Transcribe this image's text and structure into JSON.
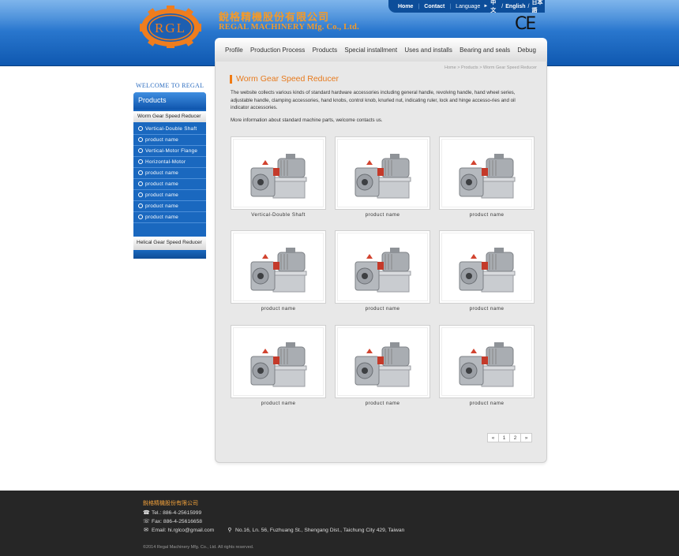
{
  "header": {
    "company_cn": "銳格精機股份有限公司",
    "company_en": "REGAL MACHINERY Mfg. Co., Ltd.",
    "logo_text": "RGL",
    "ce_mark": "CE"
  },
  "topbar": {
    "home": "Home",
    "contact": "Contact",
    "language": "Language",
    "lang_options": [
      "中文",
      "English",
      "日本語"
    ]
  },
  "nav": [
    "Profile",
    "Production Process",
    "Products",
    "Special installment",
    "Uses and installs",
    "Bearing and seals",
    "Debug"
  ],
  "sidebar": {
    "welcome": "WELCOME TO REGAL",
    "heading": "Products",
    "category_selected": "Worm Gear Speed Reducer",
    "items": [
      "Vertical-Double Shaft",
      "product name",
      "Vertical-Motor Flange",
      "Horizontal-Motor",
      "product name",
      "product name",
      "product name",
      "product name",
      "product name"
    ],
    "category_other": "Helical Gear Speed Reducer"
  },
  "main": {
    "breadcrumb": "Home > Products > Worm Gear Speed Reducer",
    "title": "Worm Gear Speed Reducer",
    "description": "The website collects various kinds of standard hardware accessories including general handle, revolving handle, hand wheel series, adjustable handle, clamping accessories, hand knobs, control knob, knurled nut, indicating ruler, lock and hinge accesso-ries and oil indicator accessories.",
    "more_info": "More information about standard machine parts, welcome contacts us.",
    "products": [
      "Vertical-Double Shaft",
      "product name",
      "product name",
      "product name",
      "product name",
      "product name",
      "product name",
      "product name",
      "product name"
    ],
    "pagination": [
      "«",
      "1",
      "2",
      "»"
    ]
  },
  "footer": {
    "company": "銳格精機股份有限公司",
    "tel": "Tel.: 886-4-25615999",
    "fax": "Fax: 886-4-25616658",
    "email": "Email: hi.rglco@gmail.com",
    "address": "No.16, Ln. 56, Fuzhuang St., Shengang Dist., Taichung City 429, Taiwan",
    "copyright": "©2014 Regal Machinery Mfg. Co., Ltd.  All rights reserved."
  },
  "colors": {
    "header_blue": "#1f6cc4",
    "accent_orange": "#f39a2a",
    "sidebar_blue": "#1a68bf",
    "footer_bg": "#262626"
  }
}
